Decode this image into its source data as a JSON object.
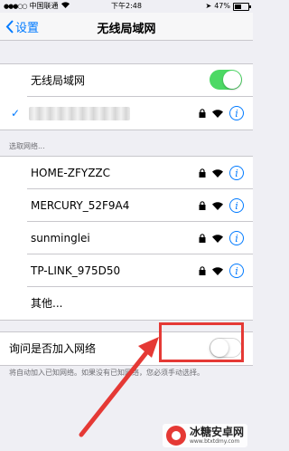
{
  "status": {
    "carrier": "中国联通",
    "time": "下午2:48",
    "battery": "47%"
  },
  "nav": {
    "back_label": "设置",
    "title": "无线局域网"
  },
  "wifi": {
    "toggle_label": "无线局域网",
    "enabled": true
  },
  "networks_header": "选取网络...",
  "networks": [
    {
      "name": "HOME-ZFYZZC"
    },
    {
      "name": "MERCURY_52F9A4"
    },
    {
      "name": "sunminglei"
    },
    {
      "name": "TP-LINK_975D50"
    }
  ],
  "other_label": "其他...",
  "ask_join": {
    "label": "询问是否加入网络",
    "enabled": false,
    "note": "将自动加入已知网络。如果没有已知网络，您必须手动选择。"
  },
  "watermark": {
    "name": "冰糖安卓网",
    "url": "www.btxtdmy.com"
  },
  "colors": {
    "accent": "#007aff",
    "toggle_on": "#4cd964",
    "annotation": "#e53935"
  }
}
